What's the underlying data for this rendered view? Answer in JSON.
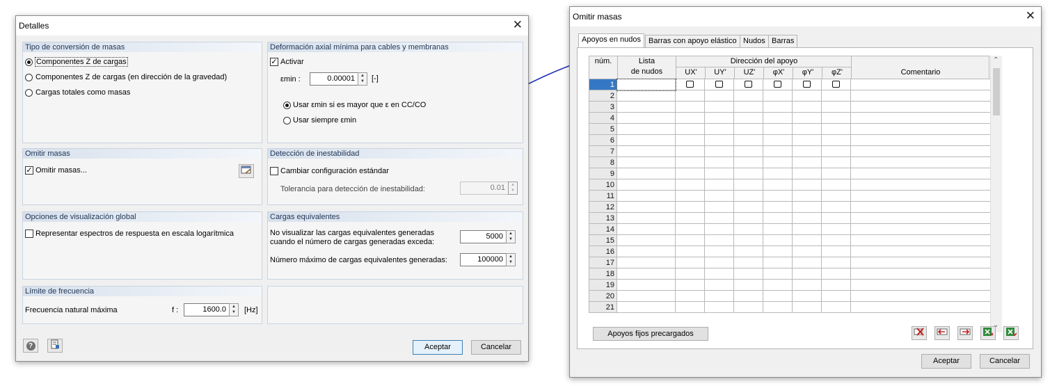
{
  "detalles": {
    "title": "Detalles",
    "tipo": {
      "header": "Tipo de conversión de masas",
      "options": [
        "Componentes Z de cargas",
        "Componentes Z de cargas (en dirección de la gravedad)",
        "Cargas totales como masas"
      ],
      "selected": 0
    },
    "deform": {
      "header": "Deformación axial mínima para cables y membranas",
      "activar": "Activar",
      "emin_label": "εmin :",
      "emin_value": "0.00001",
      "emin_unit": "[-]",
      "opt1": "Usar εmin si es mayor que ε en CC/CO",
      "opt2": "Usar siempre εmin"
    },
    "omitir": {
      "header": "Omitir masas",
      "label": "Omitir masas..."
    },
    "detec": {
      "header": "Detección de inestabilidad",
      "cambiar": "Cambiar configuración estándar",
      "tol_label": "Tolerancia para detección de inestabilidad:",
      "tol_value": "0.01"
    },
    "vis": {
      "header": "Opciones de visualización global",
      "label": "Representar espectros de respuesta en escala logarítmica"
    },
    "equiv": {
      "header": "Cargas equivalentes",
      "line1": "No visualizar las cargas equivalentes generadas",
      "line2": "cuando el número de cargas generadas exceda:",
      "value1": "5000",
      "label2": "Número máximo de cargas equivalentes generadas:",
      "value2": "100000"
    },
    "freq": {
      "header": "Límite de frecuencia",
      "label": "Frecuencia natural máxima",
      "f_label": "f :",
      "value": "1600.0",
      "unit": "[Hz]"
    },
    "ok": "Aceptar",
    "cancel": "Cancelar"
  },
  "omitir_masas": {
    "title": "Omitir masas",
    "tabs": [
      "Apoyos en nudos",
      "Barras con apoyo elástico",
      "Nudos",
      "Barras"
    ],
    "header": {
      "num": "núm.",
      "lista1": "Lista",
      "lista2": "de nudos",
      "direccion": "Dirección del apoyo",
      "cols": [
        "UX'",
        "UY'",
        "UZ'",
        "φX'",
        "φY'",
        "φZ'"
      ],
      "comentario": "Comentario"
    },
    "rows": [
      "1",
      "2",
      "3",
      "4",
      "5",
      "6",
      "7",
      "8",
      "9",
      "10",
      "11",
      "12",
      "13",
      "14",
      "15",
      "16",
      "17",
      "18",
      "19",
      "20",
      "21"
    ],
    "preload_button": "Apoyos fijos precargados",
    "ok": "Aceptar",
    "cancel": "Cancelar"
  }
}
